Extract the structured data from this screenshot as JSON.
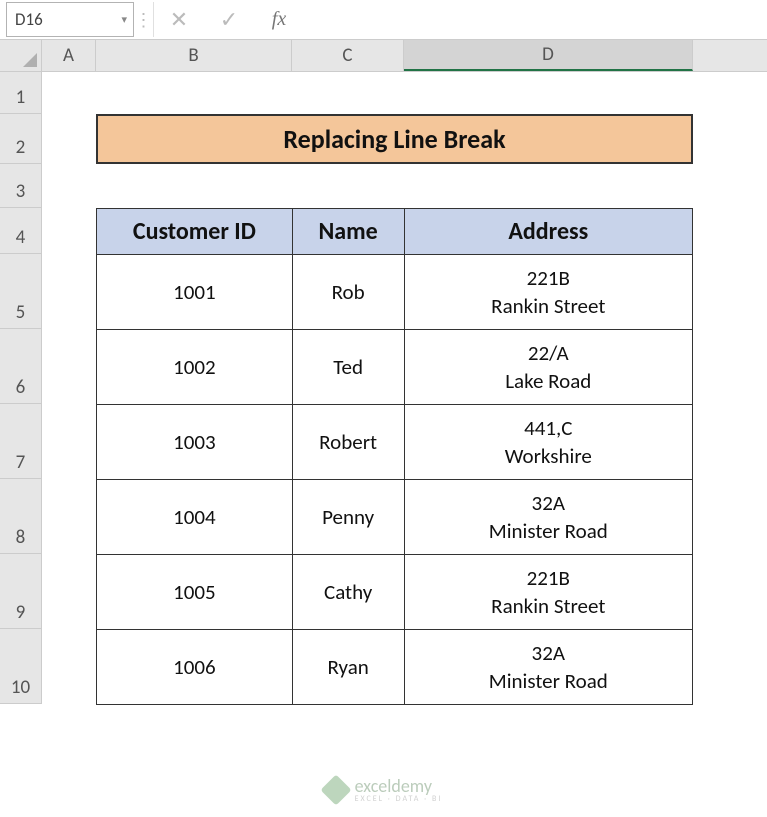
{
  "nameBox": {
    "value": "D16"
  },
  "formulaBar": {
    "cancel": "✕",
    "confirm": "✓",
    "fx": "fx",
    "value": ""
  },
  "columns": [
    "A",
    "B",
    "C",
    "D"
  ],
  "activeColumn": "D",
  "rows": [
    "1",
    "2",
    "3",
    "4",
    "5",
    "6",
    "7",
    "8",
    "9",
    "10"
  ],
  "title": "Replacing Line Break",
  "table": {
    "headers": {
      "id": "Customer ID",
      "name": "Name",
      "address": "Address"
    },
    "rows": [
      {
        "id": "1001",
        "name": "Rob",
        "addr1": "221B",
        "addr2": "Rankin Street"
      },
      {
        "id": "1002",
        "name": "Ted",
        "addr1": "22/A",
        "addr2": "Lake Road"
      },
      {
        "id": "1003",
        "name": "Robert",
        "addr1": "441,C",
        "addr2": "Workshire"
      },
      {
        "id": "1004",
        "name": "Penny",
        "addr1": "32A",
        "addr2": "Minister Road"
      },
      {
        "id": "1005",
        "name": "Cathy",
        "addr1": "221B",
        "addr2": "Rankin Street"
      },
      {
        "id": "1006",
        "name": "Ryan",
        "addr1": "32A",
        "addr2": "Minister Road"
      }
    ]
  },
  "watermark": {
    "main": "exceldemy",
    "sub": "EXCEL · DATA · BI"
  }
}
